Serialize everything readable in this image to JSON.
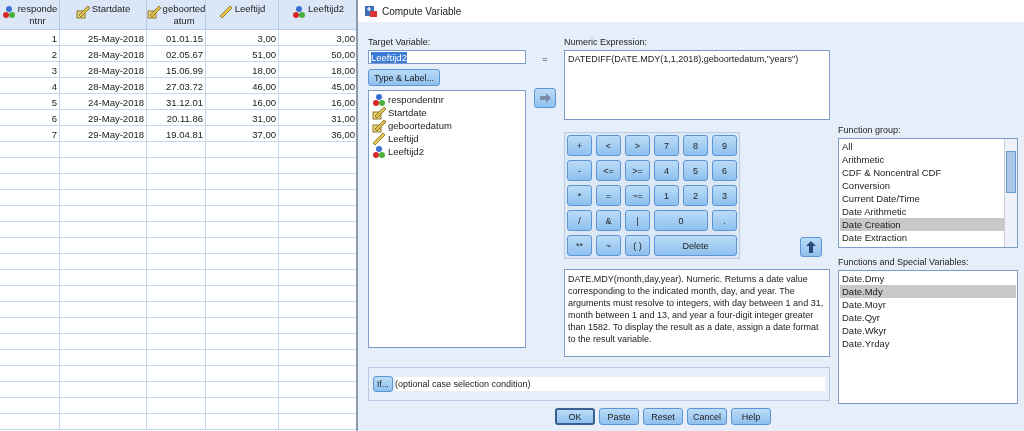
{
  "data_view": {
    "columns": [
      {
        "label": "responde ntnr",
        "kind": "nominal"
      },
      {
        "label": "Startdate",
        "kind": "date"
      },
      {
        "label": "geboorted atum",
        "kind": "date"
      },
      {
        "label": "Leeftijd",
        "kind": "scale"
      },
      {
        "label": "Leeftijd2",
        "kind": "nominal"
      }
    ],
    "rows": [
      [
        "1",
        "25-May-2018",
        "01.01.15",
        "3,00",
        "3,00"
      ],
      [
        "2",
        "28-May-2018",
        "02.05.67",
        "51,00",
        "50,00"
      ],
      [
        "3",
        "28-May-2018",
        "15.06.99",
        "18,00",
        "18,00"
      ],
      [
        "4",
        "28-May-2018",
        "27.03.72",
        "46,00",
        "45,00"
      ],
      [
        "5",
        "24-May-2018",
        "31.12.01",
        "16,00",
        "16,00"
      ],
      [
        "6",
        "29-May-2018",
        "20.11.86",
        "31,00",
        "31,00"
      ],
      [
        "7",
        "29-May-2018",
        "19.04.81",
        "37,00",
        "36,00"
      ]
    ]
  },
  "dialog": {
    "title": "Compute Variable",
    "target_variable": {
      "label": "Target Variable:",
      "value": "Leeftijd2",
      "text_selected": true
    },
    "type_label_button": "Type & Label...",
    "variables": [
      {
        "name": "respondentnr",
        "kind": "nominal"
      },
      {
        "name": "Startdate",
        "kind": "date"
      },
      {
        "name": "geboortedatum",
        "kind": "date"
      },
      {
        "name": "Leeftijd",
        "kind": "scale"
      },
      {
        "name": "Leeftijd2",
        "kind": "nominal"
      }
    ],
    "equals": "=",
    "numeric_expression": {
      "label": "Numeric Expression:",
      "value": "DATEDIFF(DATE.MDY(1,1,2018),geboortedatum,\"years\")"
    },
    "keypad": [
      {
        "label": "+"
      },
      {
        "label": "<"
      },
      {
        "label": ">"
      },
      {
        "label": "7"
      },
      {
        "label": "8"
      },
      {
        "label": "9"
      },
      {
        "label": "-"
      },
      {
        "label": "<="
      },
      {
        "label": ">="
      },
      {
        "label": "4"
      },
      {
        "label": "5"
      },
      {
        "label": "6"
      },
      {
        "label": "*"
      },
      {
        "label": "="
      },
      {
        "label": "~="
      },
      {
        "label": "1"
      },
      {
        "label": "2"
      },
      {
        "label": "3"
      },
      {
        "label": "/"
      },
      {
        "label": "&"
      },
      {
        "label": "|"
      },
      {
        "label": "0",
        "kind": "double"
      },
      {
        "label": "."
      },
      {
        "label": "**"
      },
      {
        "label": "~"
      },
      {
        "label": "( )"
      },
      {
        "label": "Delete",
        "kind": "triple"
      }
    ],
    "description": "DATE.MDY(month,day,year). Numeric. Returns a date value corresponding to the indicated month, day, and year. The arguments must resolve to integers, with day between 1 and 31, month between 1 and 13, and year a four-digit integer greater than 1582. To display the result as a date, assign a date format to the result variable.",
    "function_group": {
      "label": "Function group:",
      "items": [
        {
          "label": "All",
          "selected": false
        },
        {
          "label": "Arithmetic",
          "selected": false
        },
        {
          "label": "CDF & Noncentral CDF",
          "selected": false
        },
        {
          "label": "Conversion",
          "selected": false
        },
        {
          "label": "Current Date/Time",
          "selected": false
        },
        {
          "label": "Date Arithmetic",
          "selected": false
        },
        {
          "label": "Date Creation",
          "selected": true
        },
        {
          "label": "Date Extraction",
          "selected": false
        }
      ]
    },
    "functions": {
      "label": "Functions and Special Variables:",
      "items": [
        {
          "label": "Date.Dmy",
          "selected": false
        },
        {
          "label": "Date.Mdy",
          "selected": true
        },
        {
          "label": "Date.Moyr",
          "selected": false
        },
        {
          "label": "Date.Qyr",
          "selected": false
        },
        {
          "label": "Date.Wkyr",
          "selected": false
        },
        {
          "label": "Date.Yrday",
          "selected": false
        }
      ]
    },
    "if_button": "If...",
    "if_condition": "(optional case selection condition)",
    "buttons": [
      {
        "label": "OK",
        "default": true
      },
      {
        "label": "Paste",
        "default": false
      },
      {
        "label": "Reset",
        "default": false
      },
      {
        "label": "Cancel",
        "default": false
      },
      {
        "label": "Help",
        "default": false
      }
    ]
  }
}
